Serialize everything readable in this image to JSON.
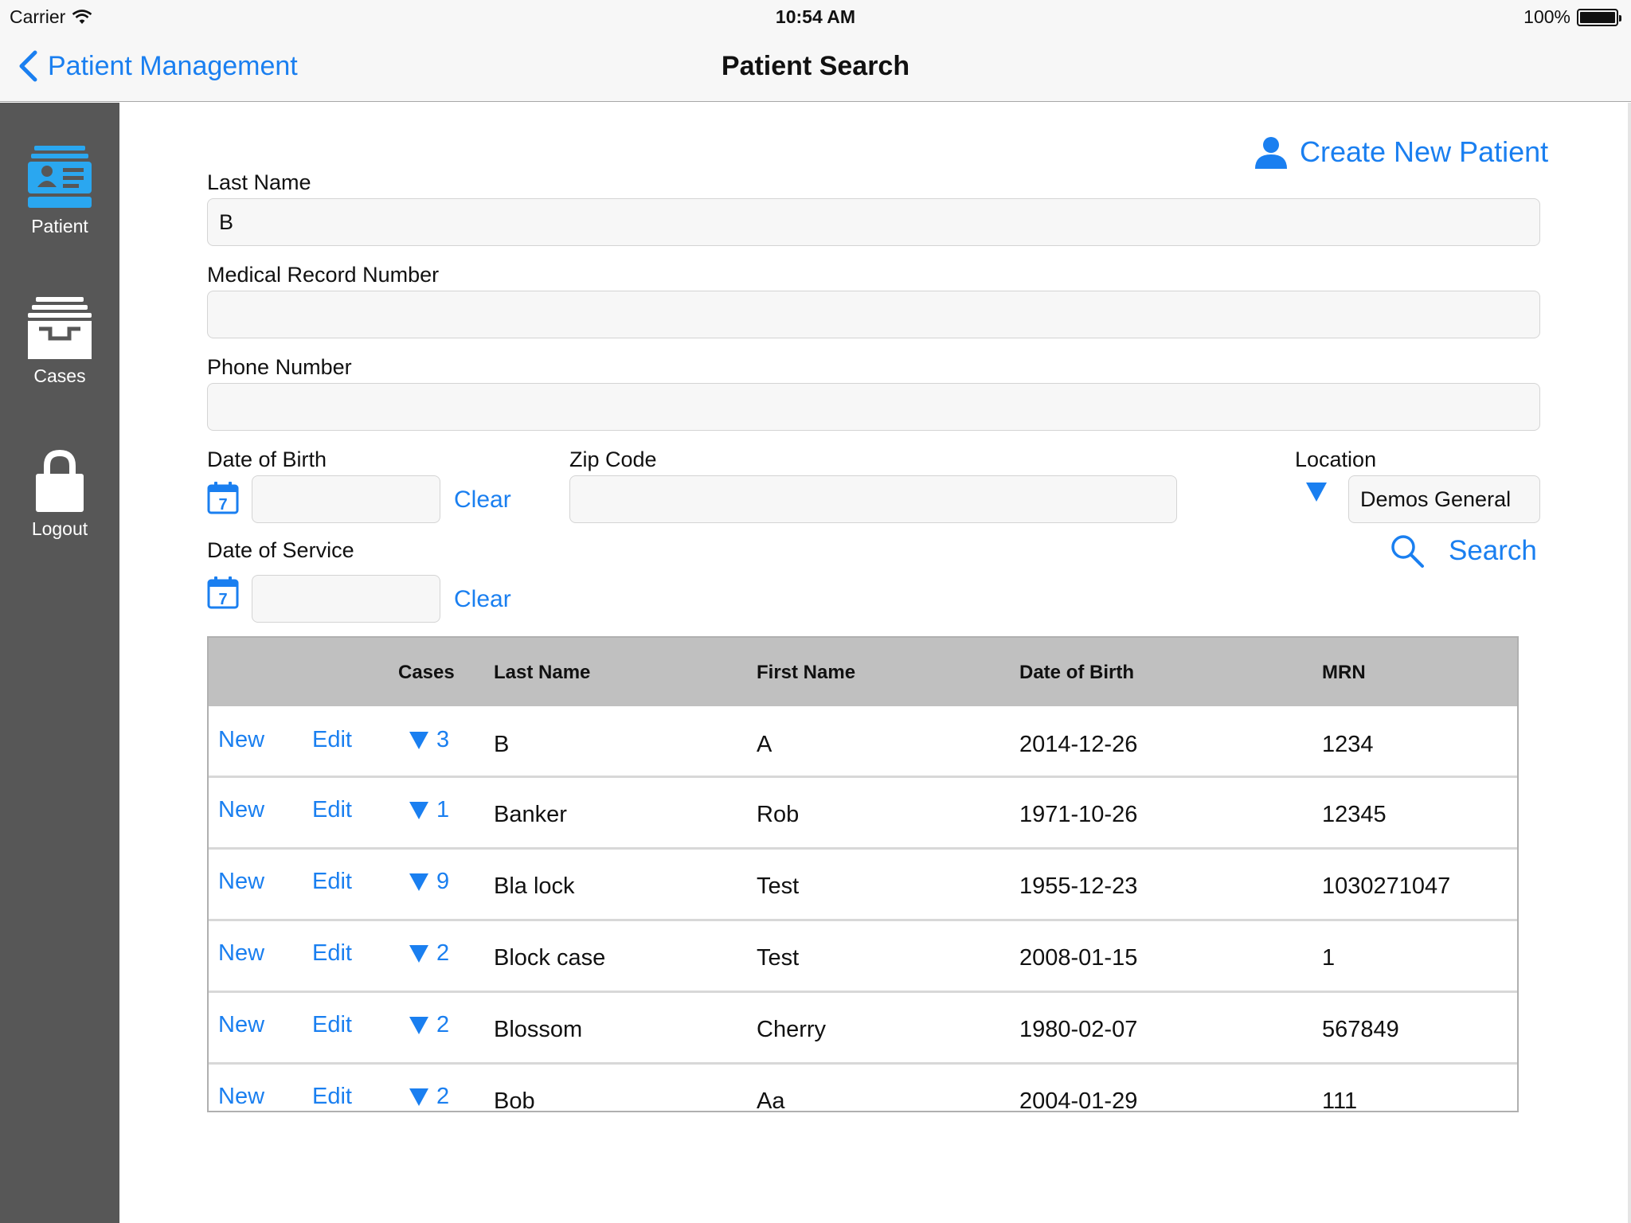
{
  "status_bar": {
    "carrier": "Carrier",
    "time": "10:54 AM",
    "battery": "100%"
  },
  "nav": {
    "back_label": "Patient Management",
    "title": "Patient Search"
  },
  "sidebar": {
    "items": [
      {
        "label": "Patient",
        "icon": "patient-card-icon"
      },
      {
        "label": "Cases",
        "icon": "cases-tray-icon"
      },
      {
        "label": "Logout",
        "icon": "lock-icon"
      }
    ]
  },
  "form": {
    "create_new_patient": "Create New Patient",
    "last_name": {
      "label": "Last Name",
      "value": "B"
    },
    "mrn": {
      "label": "Medical Record Number",
      "value": ""
    },
    "phone": {
      "label": "Phone Number",
      "value": ""
    },
    "dob": {
      "label": "Date of Birth",
      "value": "",
      "clear": "Clear",
      "calendar_day": "7"
    },
    "zip": {
      "label": "Zip Code",
      "value": ""
    },
    "location": {
      "label": "Location",
      "value": "Demos General"
    },
    "dos": {
      "label": "Date of Service",
      "value": "",
      "clear": "Clear",
      "calendar_day": "7"
    },
    "search_label": "Search"
  },
  "table": {
    "headers": {
      "cases": "Cases",
      "last_name": "Last Name",
      "first_name": "First Name",
      "dob": "Date of Birth",
      "mrn": "MRN"
    },
    "new_label": "New",
    "edit_label": "Edit",
    "rows": [
      {
        "cases": "3",
        "last_name": "B",
        "first_name": "A",
        "dob": "2014-12-26",
        "mrn": "1234"
      },
      {
        "cases": "1",
        "last_name": "Banker",
        "first_name": "Rob",
        "dob": "1971-10-26",
        "mrn": "12345"
      },
      {
        "cases": "9",
        "last_name": "Bla lock",
        "first_name": "Test",
        "dob": "1955-12-23",
        "mrn": "1030271047"
      },
      {
        "cases": "2",
        "last_name": "Block case",
        "first_name": "Test",
        "dob": "2008-01-15",
        "mrn": "1"
      },
      {
        "cases": "2",
        "last_name": "Blossom",
        "first_name": "Cherry",
        "dob": "1980-02-07",
        "mrn": "567849"
      },
      {
        "cases": "2",
        "last_name": "Bob",
        "first_name": "Aa",
        "dob": "2004-01-29",
        "mrn": "111"
      }
    ]
  },
  "colors": {
    "accent": "#1a7ff0",
    "sidebar_bg": "#575757",
    "active_icon": "#2aa7f0",
    "table_header_bg": "#c0c0c0"
  }
}
